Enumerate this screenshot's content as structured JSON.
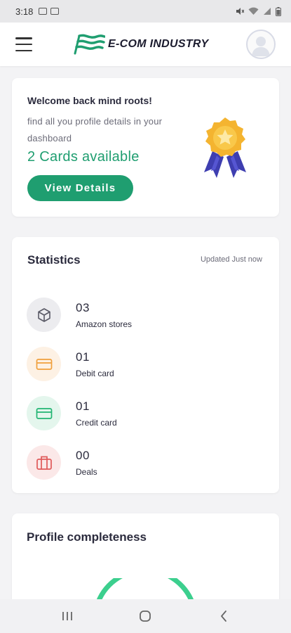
{
  "status_bar": {
    "time": "3:18",
    "icons_left": [
      "gallery-icon",
      "image-icon"
    ],
    "icons_right": [
      "mute-icon",
      "wifi-icon",
      "signal-icon",
      "battery-icon"
    ]
  },
  "app_bar": {
    "brand": "E-COM INDUSTRY",
    "brand_color": "#1f9e70"
  },
  "welcome": {
    "title": "Welcome back mind roots!",
    "subtitle": "find all you profile details in your dashboard",
    "cards_available": "2 Cards available",
    "button_label": "View Details"
  },
  "statistics": {
    "title": "Statistics",
    "updated": "Updated Just now",
    "items": [
      {
        "value": "03",
        "label": "Amazon stores",
        "icon": "box-icon",
        "color": "#5a5a66",
        "bg": "#ececef"
      },
      {
        "value": "01",
        "label": "Debit card",
        "icon": "debit-card-icon",
        "color": "#f0a03c",
        "bg": "#fdf1e4"
      },
      {
        "value": "01",
        "label": "Credit card",
        "icon": "credit-card-icon",
        "color": "#22b573",
        "bg": "#e4f6ed"
      },
      {
        "value": "00",
        "label": "Deals",
        "icon": "deals-icon",
        "color": "#e05a5a",
        "bg": "#fbe8e8"
      }
    ]
  },
  "profile": {
    "title": "Profile completeness",
    "arc_color": "#3ccf8e"
  },
  "colors": {
    "accent": "#1f9e70",
    "background": "#f3f3f5"
  }
}
